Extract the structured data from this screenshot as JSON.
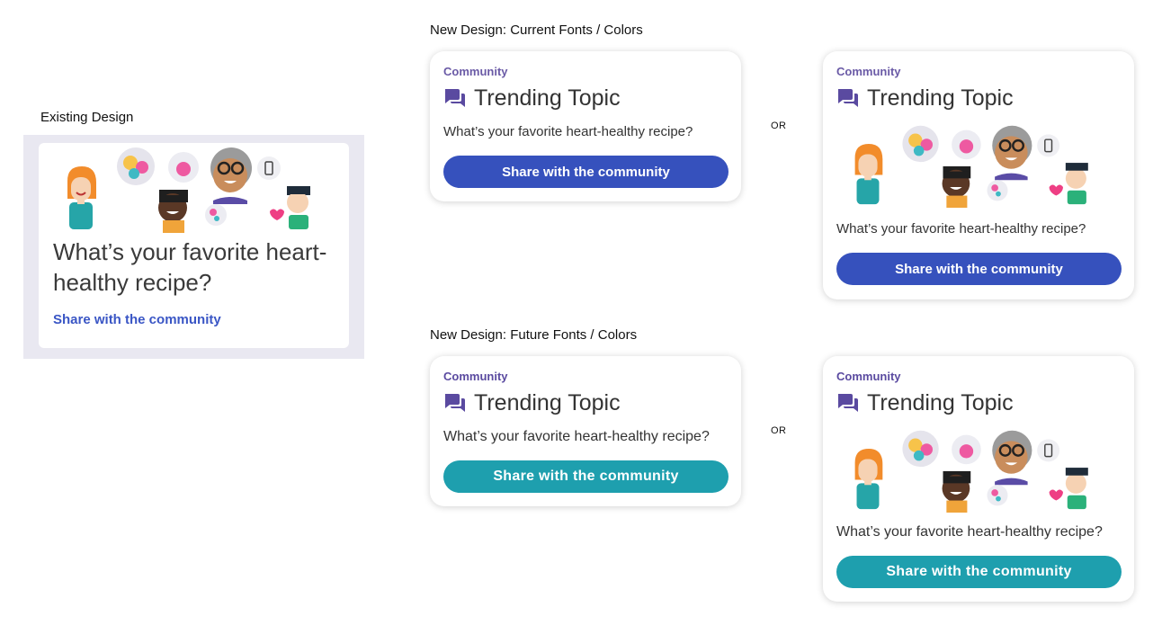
{
  "labels": {
    "existing": "Existing Design",
    "current": "New Design: Current Fonts / Colors",
    "future": "New Design: Future Fonts / Colors",
    "or": "OR"
  },
  "existing": {
    "question": "What’s your favorite heart-healthy recipe?",
    "link": "Share with the community"
  },
  "card": {
    "kicker": "Community",
    "title": "Trending Topic",
    "question": "What’s your favorite heart-healthy recipe?",
    "cta": "Share with the community"
  },
  "colors": {
    "kicker": "#6a5aa6",
    "icon": "#5a4aa0",
    "cta_current": "#3651bd",
    "cta_future": "#1e9fae",
    "link": "#3a56c5"
  },
  "icons": [
    "chat-bubbles-icon",
    "phone-icon",
    "heart-icon"
  ]
}
